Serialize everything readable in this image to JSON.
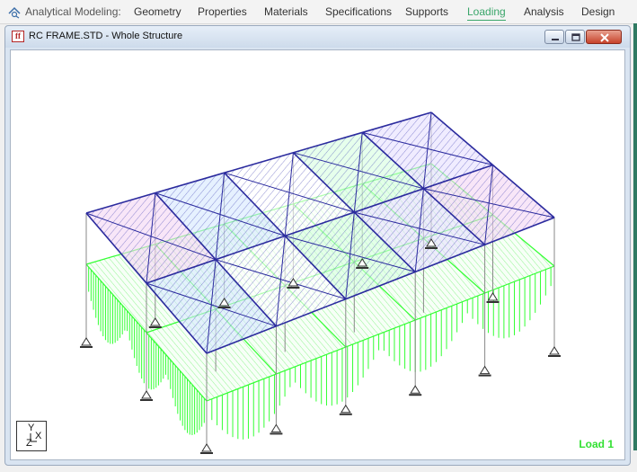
{
  "ribbon": {
    "icon": "analytical-modeling-icon",
    "tabs": [
      {
        "label": "Analytical Modeling:"
      },
      {
        "label": "Geometry"
      },
      {
        "label": "Properties"
      },
      {
        "label": "Materials"
      },
      {
        "label": "Specifications"
      },
      {
        "label": "Supports"
      },
      {
        "label": "Loading",
        "active": true
      },
      {
        "label": "Analysis"
      },
      {
        "label": "Design"
      }
    ],
    "active_color": "#3aa66a"
  },
  "window": {
    "title": "RC FRAME.STD - Whole Structure",
    "icon_text": "ff"
  },
  "viewport": {
    "axis": {
      "y": "Y",
      "x": "X",
      "z": "Z"
    },
    "load_label": "Load 1",
    "colors": {
      "frame": "#2b2b9e",
      "load": "#33ff33",
      "column": "#888888",
      "support": "#333333"
    }
  }
}
